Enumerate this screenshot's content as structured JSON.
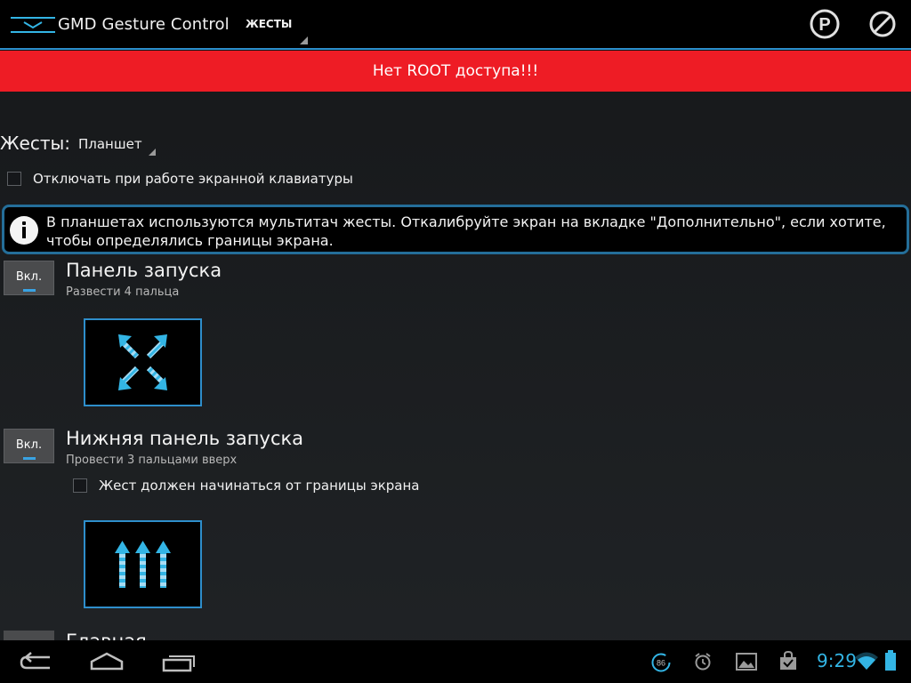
{
  "action_bar": {
    "app_icon": "gmd-logo-icon",
    "title": "GMD Gesture Control",
    "nav_tab": "ЖЕСТЫ",
    "buttons": [
      "parking-icon",
      "disable-icon"
    ]
  },
  "banner": {
    "text": "Нет ROOT доступа!!!",
    "color": "#ee1c25"
  },
  "gestures": {
    "label": "Жесты:",
    "selected": "Планшет"
  },
  "keyboard_checkbox": {
    "label": "Отключать при работе экранной клавиатуры",
    "checked": false
  },
  "info": {
    "icon": "info-icon",
    "text": "В планшетах используются мультитач жесты. Откалибруйте экран на вкладке \"Дополнительно\", если хотите, чтобы определялись границы экрана."
  },
  "items": [
    {
      "toggle": "Вкл.",
      "title": "Панель запуска",
      "subtitle": "Развести 4 пальца",
      "preview_icon": "four-finger-spread-icon"
    },
    {
      "toggle": "Вкл.",
      "title": "Нижняя панель запуска",
      "subtitle": "Провести 3 пальцами вверх",
      "checkbox_label": "Жест должен начинаться от границы экрана",
      "checkbox_checked": false,
      "preview_icon": "three-finger-swipe-up-icon"
    },
    {
      "title": "Главная"
    }
  ],
  "system_bar": {
    "nav": [
      "back-icon",
      "home-icon",
      "recent-apps-icon"
    ],
    "status_icons": [
      "battery-level-badge-icon",
      "alarm-icon",
      "gallery-icon",
      "shopping-bag-icon",
      "wifi-icon",
      "battery-icon"
    ],
    "badge": "86",
    "time": "9:29"
  },
  "colors": {
    "accent": "#33b5e5",
    "frame": "#2e8ecb",
    "banner": "#ee1c25"
  }
}
